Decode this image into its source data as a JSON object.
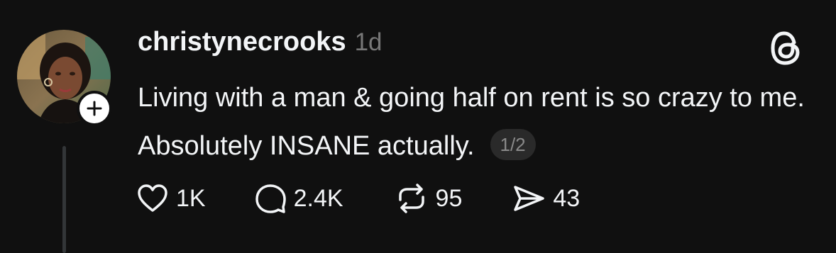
{
  "post": {
    "username": "christynecrooks",
    "time": "1d",
    "text": "Living with a man & going half on rent is so crazy to me. Absolutely INSANE actually.",
    "page_indicator": "1/2",
    "avatar_icon": "user-avatar",
    "follow_icon": "plus-icon",
    "app_icon": "threads-logo-icon"
  },
  "actions": {
    "like": {
      "icon": "heart-icon",
      "count": "1K"
    },
    "reply": {
      "icon": "comment-icon",
      "count": "2.4K"
    },
    "repost": {
      "icon": "repost-icon",
      "count": "95"
    },
    "share": {
      "icon": "send-icon",
      "count": "43"
    }
  },
  "colors": {
    "background": "#101010",
    "text": "#f3f5f7",
    "secondary_text": "#777777",
    "thread_line": "#333638"
  }
}
